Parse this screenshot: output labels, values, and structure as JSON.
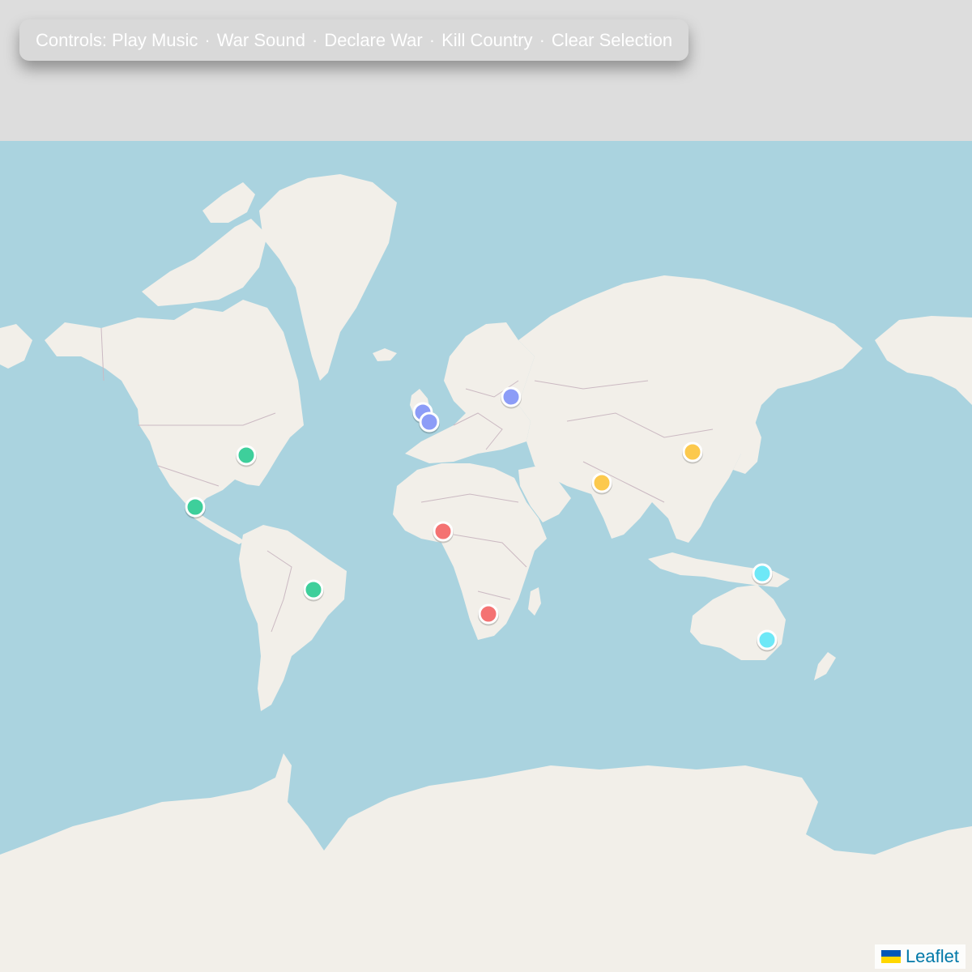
{
  "controls": {
    "prefix": "Controls:",
    "items": [
      "Play Music",
      "War Sound",
      "Declare War",
      "Kill Country",
      "Clear Selection"
    ],
    "separator": "·"
  },
  "map": {
    "colors": {
      "ocean": "#aad3df",
      "land": "#f2efe9",
      "border": "#cbb9c2"
    },
    "markers": [
      {
        "id": "usa-east",
        "group": "americas",
        "color": "#3ecf9b"
      },
      {
        "id": "mexico",
        "group": "americas",
        "color": "#3ecf9b"
      },
      {
        "id": "brazil",
        "group": "americas",
        "color": "#3ecf9b"
      },
      {
        "id": "uk",
        "group": "europe",
        "color": "#8c9cf7"
      },
      {
        "id": "france",
        "group": "europe",
        "color": "#8c9cf7"
      },
      {
        "id": "russia",
        "group": "europe",
        "color": "#8c9cf7"
      },
      {
        "id": "nigeria",
        "group": "africa",
        "color": "#f47272"
      },
      {
        "id": "south-africa",
        "group": "africa",
        "color": "#f47272"
      },
      {
        "id": "india",
        "group": "asia",
        "color": "#fcc94d"
      },
      {
        "id": "china",
        "group": "asia",
        "color": "#fcc94d"
      },
      {
        "id": "new-guinea",
        "group": "oceania",
        "color": "#6ee8f7"
      },
      {
        "id": "australia",
        "group": "oceania",
        "color": "#6ee8f7"
      }
    ]
  },
  "attribution": {
    "label": "Leaflet",
    "flag_colors": [
      "#0057b7",
      "#ffd700"
    ]
  }
}
